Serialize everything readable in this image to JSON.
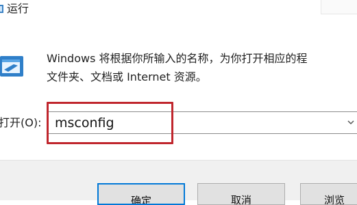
{
  "window": {
    "title": "运行",
    "title_icon": "run-dialog-icon"
  },
  "dialog": {
    "icon": "run-program-icon",
    "description_line1": "Windows 将根据你所输入的名称，为你打开相应的程",
    "description_line2": "文件夹、文档或 Internet 资源。"
  },
  "open_field": {
    "label": "打开(O):",
    "value": "msconfig"
  },
  "buttons": {
    "ok": "确定",
    "cancel": "取消",
    "browse": "浏览"
  },
  "colors": {
    "highlight": "#c0262d",
    "focus": "#0078d7",
    "footer": "#f0f0f0"
  }
}
